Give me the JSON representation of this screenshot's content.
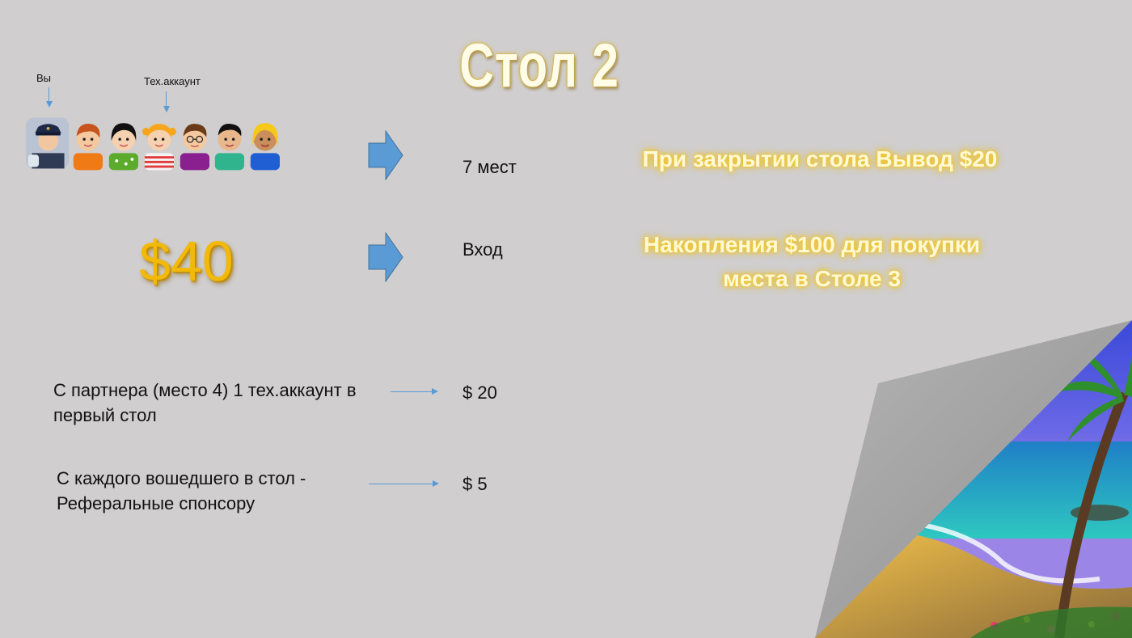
{
  "slide": {
    "title": "Стол 2",
    "label_you": "Вы",
    "label_tech": "Тех.аккаунт",
    "seats": "7 мест",
    "entry_label": "Вход",
    "entry_price": "$40",
    "payout": "При  закрытии стола Вывод $20",
    "savings_line1": "Накопления $100 для покупки",
    "savings_line2": "места в Столе 3",
    "partner_line1": "С партнера (место 4) 1 тех.аккаунт в",
    "partner_line2": "первый стол",
    "partner_amount": "$ 20",
    "referral_line1": "С каждого вошедшего в стол -",
    "referral_line2": "Реферальные спонсору",
    "referral_amount": "$ 5"
  },
  "colors": {
    "background": "#d0cece",
    "arrow_blue": "#5b9bd5",
    "gold": "#f2b90a",
    "glow": "#f3c829"
  }
}
